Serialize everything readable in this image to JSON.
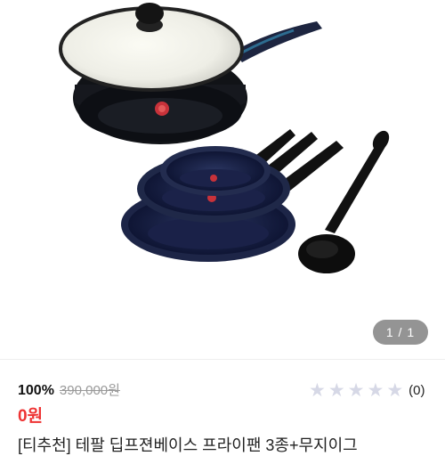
{
  "gallery": {
    "product_image": "tefal-deep-frypan-and-ladle-set",
    "pager_text": "1 / 1"
  },
  "pricing": {
    "discount": "100%",
    "original_price": "390,000원",
    "sale_price": "0원",
    "sale_color": "#ee3333"
  },
  "rating": {
    "stars": 0,
    "max_stars": 5,
    "review_count": "(0)",
    "star_color": "#d6d8e6"
  },
  "product": {
    "title": "[티추천] 테팔 딥프젼베이스 프라이팬 3종+무지이그"
  }
}
